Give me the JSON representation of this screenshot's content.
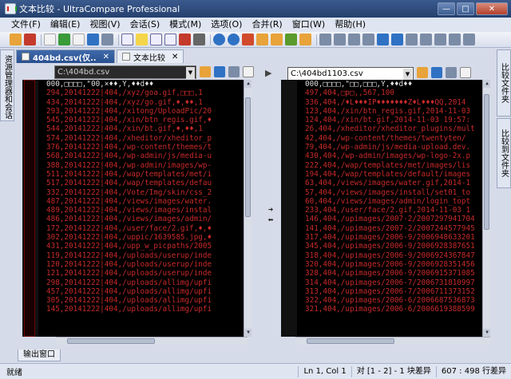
{
  "window": {
    "title": "文本比较 - UltraCompare Professional",
    "minimize": "—",
    "maximize": "□",
    "close": "✕"
  },
  "menu": [
    "文件(F)",
    "编辑(E)",
    "视图(V)",
    "会话(S)",
    "模式(M)",
    "选项(O)",
    "合并(R)",
    "窗口(W)",
    "帮助(H)"
  ],
  "side_tabs": {
    "left": "资源管理器和会话",
    "right_top": "比较文件夹",
    "right_bottom": "比较到文件夹"
  },
  "tabs": [
    {
      "label": "404bd.csv(仅..",
      "close": "✕",
      "active": true
    },
    {
      "label": "文本比较",
      "close": "✕",
      "active": false
    }
  ],
  "left": {
    "path": "C:\\404bd.csv",
    "lines": [
      "000,□□□□,\"00,×♦♦,Y,♦♦d♦♦",
      "294,20141222|404,/xyz/goa.gif,□□□,1",
      "434,20141222|404,/xyz/go.gif,♦,♦♦,1",
      "293,20141222|404,/xitong/UploadPic/20",
      "545,20141222|404,/xin/btn_regis.gif,♦",
      "544,20141222|404,/xin/bt.gif,♦,♦♦,1",
      "574,20141222|404,/xheditor/xheditor_p",
      "376,20141222|404,/wp-content/themes/t",
      "568,20141222|404,/wp-admin/js/media-u",
      "388,20141222|404,/wp-admin/images/wp-",
      "511,20141222|404,/wap/templates/met/i",
      "517,20141222|404,/wap/templates/defau",
      "332,20141222|404,/Vote/Img/skin/css_2",
      "487,20141222|404,/views/images/water.",
      "489,20141222|404,/views/images/instal",
      "486,20141222|404,/views/images/admin/",
      "172,20141222|404,/user/face/2.gif,♦,♦",
      "302,20141222|404,/uppic/1639585.jpg,♦",
      "431,20141222|404,/upp_w_picpaths/2005",
      "119,20141222|404,/uploads/userup/inde",
      "120,20141222|404,/uploads/userup/inde",
      "121,20141222|404,/uploads/userup/inde",
      "298,20141222|404,/uploads/allimg/upfi",
      "457,20141222|404,/uploads/allimg/upfi",
      "305,20141222|404,/uploads/allimg/upfi",
      "145,20141222|404,/uploads/allimg/upfi"
    ]
  },
  "right": {
    "path": "C:\\404bd1103.csv",
    "lines": [
      "000,□□□□,\"□□,□□□,Y,♦♦d♦♦",
      "497,404,□p□,,567,100",
      "336,404,/♦L♦♦♦IP♦♦♦♦♦♦♦Z♦L♦♦♦QQ,2014",
      "123,404,/xin/btn_regis.gif,2014-11-03",
      "124,404,/xin/bt.gif,2014-11-03 19:57:",
      "26,404,/xheditor/xheditor_plugins/mult",
      "42,404,/wp-content/themes/twentyten/",
      "79,404,/wp-admin/js/media-upload.dev.",
      "430,404,/wp-admin/images/wp-logo-2x.p",
      "222,404,/wap/templates/met/images/lis",
      "194,404,/wap/templates/default/images",
      "63,404,/views/images/water.gif,2014-1",
      "57,404,/views/images/install/set01_to",
      "60,404,/views/images/admin/login_topt",
      "233,404,/user/face/2.gif,2014-11-03 1",
      "146,404,/upimages/2007-2/2007297941704",
      "141,404,/upimages/2007-2/2007244577945",
      "317,404,/upimages/2006-9/2006948633201",
      "345,404,/upimages/2006-9/2006928387651",
      "318,404,/upimages/2006-9/2006924367847",
      "320,404,/upimages/2006-9/2006928351456",
      "328,404,/upimages/2006-9/2006915371085",
      "314,404,/upimages/2006-7/2006731810997",
      "313,404,/upimages/2006-7/2006711373152",
      "322,404,/upimages/2006-6/2006687536873",
      "321,404,/upimages/2006-6/2006619388599"
    ]
  },
  "output_tab": "输出窗口",
  "status": {
    "ready": "就绪",
    "position": "Ln 1, Col 1",
    "diff": "对 [1 - 2] - 1 块差异",
    "lines": "607 : 498 行差异"
  }
}
